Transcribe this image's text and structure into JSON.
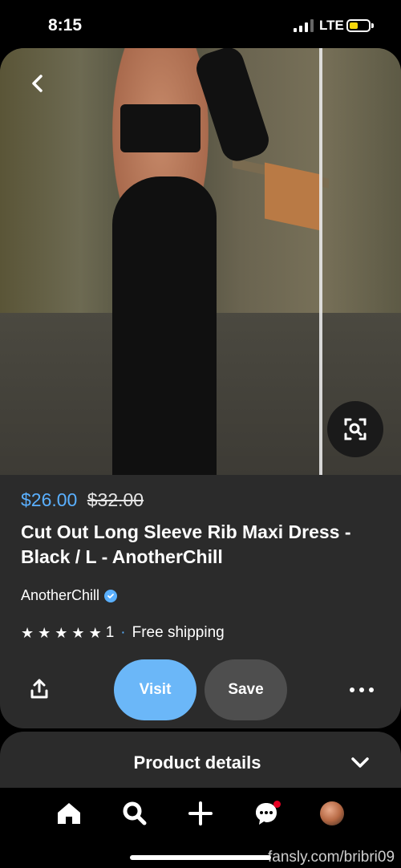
{
  "status_bar": {
    "time": "8:15",
    "network": "LTE"
  },
  "product": {
    "price_current": "$26.00",
    "price_original": "$32.00",
    "title": "Cut Out Long Sleeve Rib Maxi Dress - Black / L - AnotherChill",
    "seller": "AnotherChill",
    "rating_count": "1",
    "shipping": "Free shipping",
    "stars": 5
  },
  "actions": {
    "visit_label": "Visit",
    "save_label": "Save"
  },
  "details": {
    "label": "Product details"
  },
  "nav": [
    "home-icon",
    "search-icon",
    "plus-icon",
    "messages-icon",
    "profile-avatar"
  ],
  "watermark": "fansly.com/bribri09",
  "colors": {
    "accent_blue": "#5ab0ff",
    "visit_button": "#6bb7f8",
    "notification": "#e60023",
    "card": "#2b2b2b"
  }
}
